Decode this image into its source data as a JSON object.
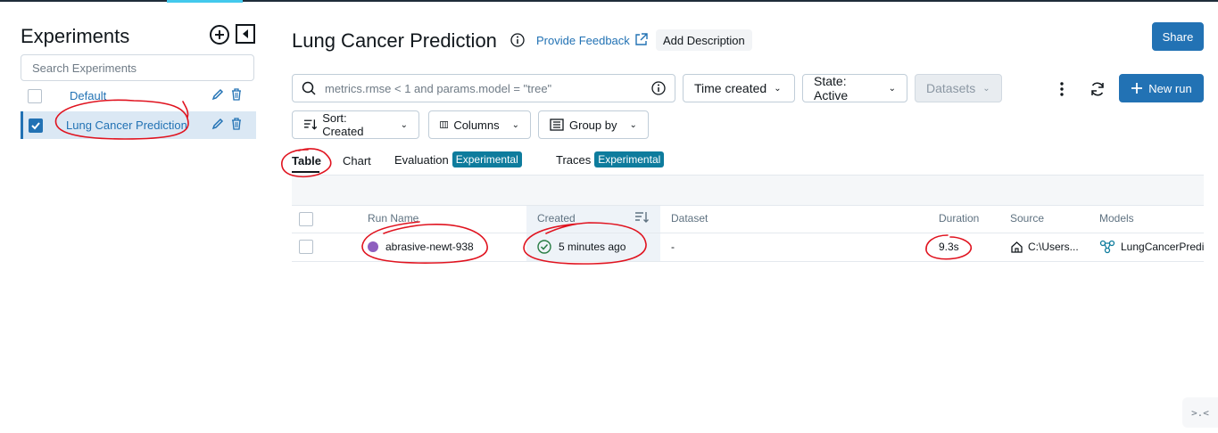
{
  "sidebar": {
    "title": "Experiments",
    "search_placeholder": "Search Experiments",
    "experiments": [
      {
        "name": "Default",
        "checked": false
      },
      {
        "name": "Lung Cancer Prediction",
        "checked": true
      }
    ]
  },
  "header": {
    "title": "Lung Cancer Prediction",
    "feedback_link": "Provide Feedback",
    "add_description": "Add Description",
    "share": "Share"
  },
  "toolbar": {
    "search_placeholder": "metrics.rmse < 1 and params.model = \"tree\"",
    "time_created": "Time created",
    "state": "State: Active",
    "datasets": "Datasets",
    "new_run": "New run",
    "sort": "Sort: Created",
    "columns": "Columns",
    "group_by": "Group by"
  },
  "tabs": [
    {
      "label": "Table",
      "active": true
    },
    {
      "label": "Chart"
    },
    {
      "label": "Evaluation",
      "badge": "Experimental"
    },
    {
      "label": "Traces",
      "badge": "Experimental"
    }
  ],
  "table": {
    "headers": [
      "Run Name",
      "Created",
      "Dataset",
      "Duration",
      "Source",
      "Models"
    ],
    "rows": [
      {
        "run_name": "abrasive-newt-938",
        "created": "5 minutes ago",
        "dataset": "-",
        "duration": "9.3s",
        "source": "C:\\Users...",
        "model": "LungCancerPredic"
      }
    ]
  },
  "colors": {
    "primary": "#2272b4",
    "badge": "#0e7c9d",
    "annotation": "#e0131f",
    "run_dot": "#8e5fbf",
    "success": "#277c43"
  }
}
